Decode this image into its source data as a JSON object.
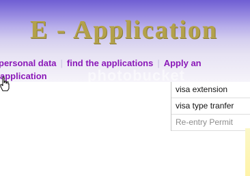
{
  "banner": {
    "title": "E - Application"
  },
  "nav": {
    "links": [
      {
        "label": "personal data"
      },
      {
        "label": "find the applications"
      },
      {
        "label": "Apply an"
      }
    ],
    "link3_continuation": "application",
    "separator": "|"
  },
  "watermark": "photobucket",
  "dropdown": {
    "items": [
      {
        "label": "visa extension",
        "enabled": true
      },
      {
        "label": "visa type tranfer",
        "enabled": true
      },
      {
        "label": "Re-entry Permit",
        "enabled": false
      }
    ]
  },
  "colors": {
    "banner_top": "#6f5ed3",
    "title_gold": "#b3a14a",
    "nav_link": "#8a18b8"
  },
  "icons": {
    "cursor": "hand-pointer-icon"
  }
}
